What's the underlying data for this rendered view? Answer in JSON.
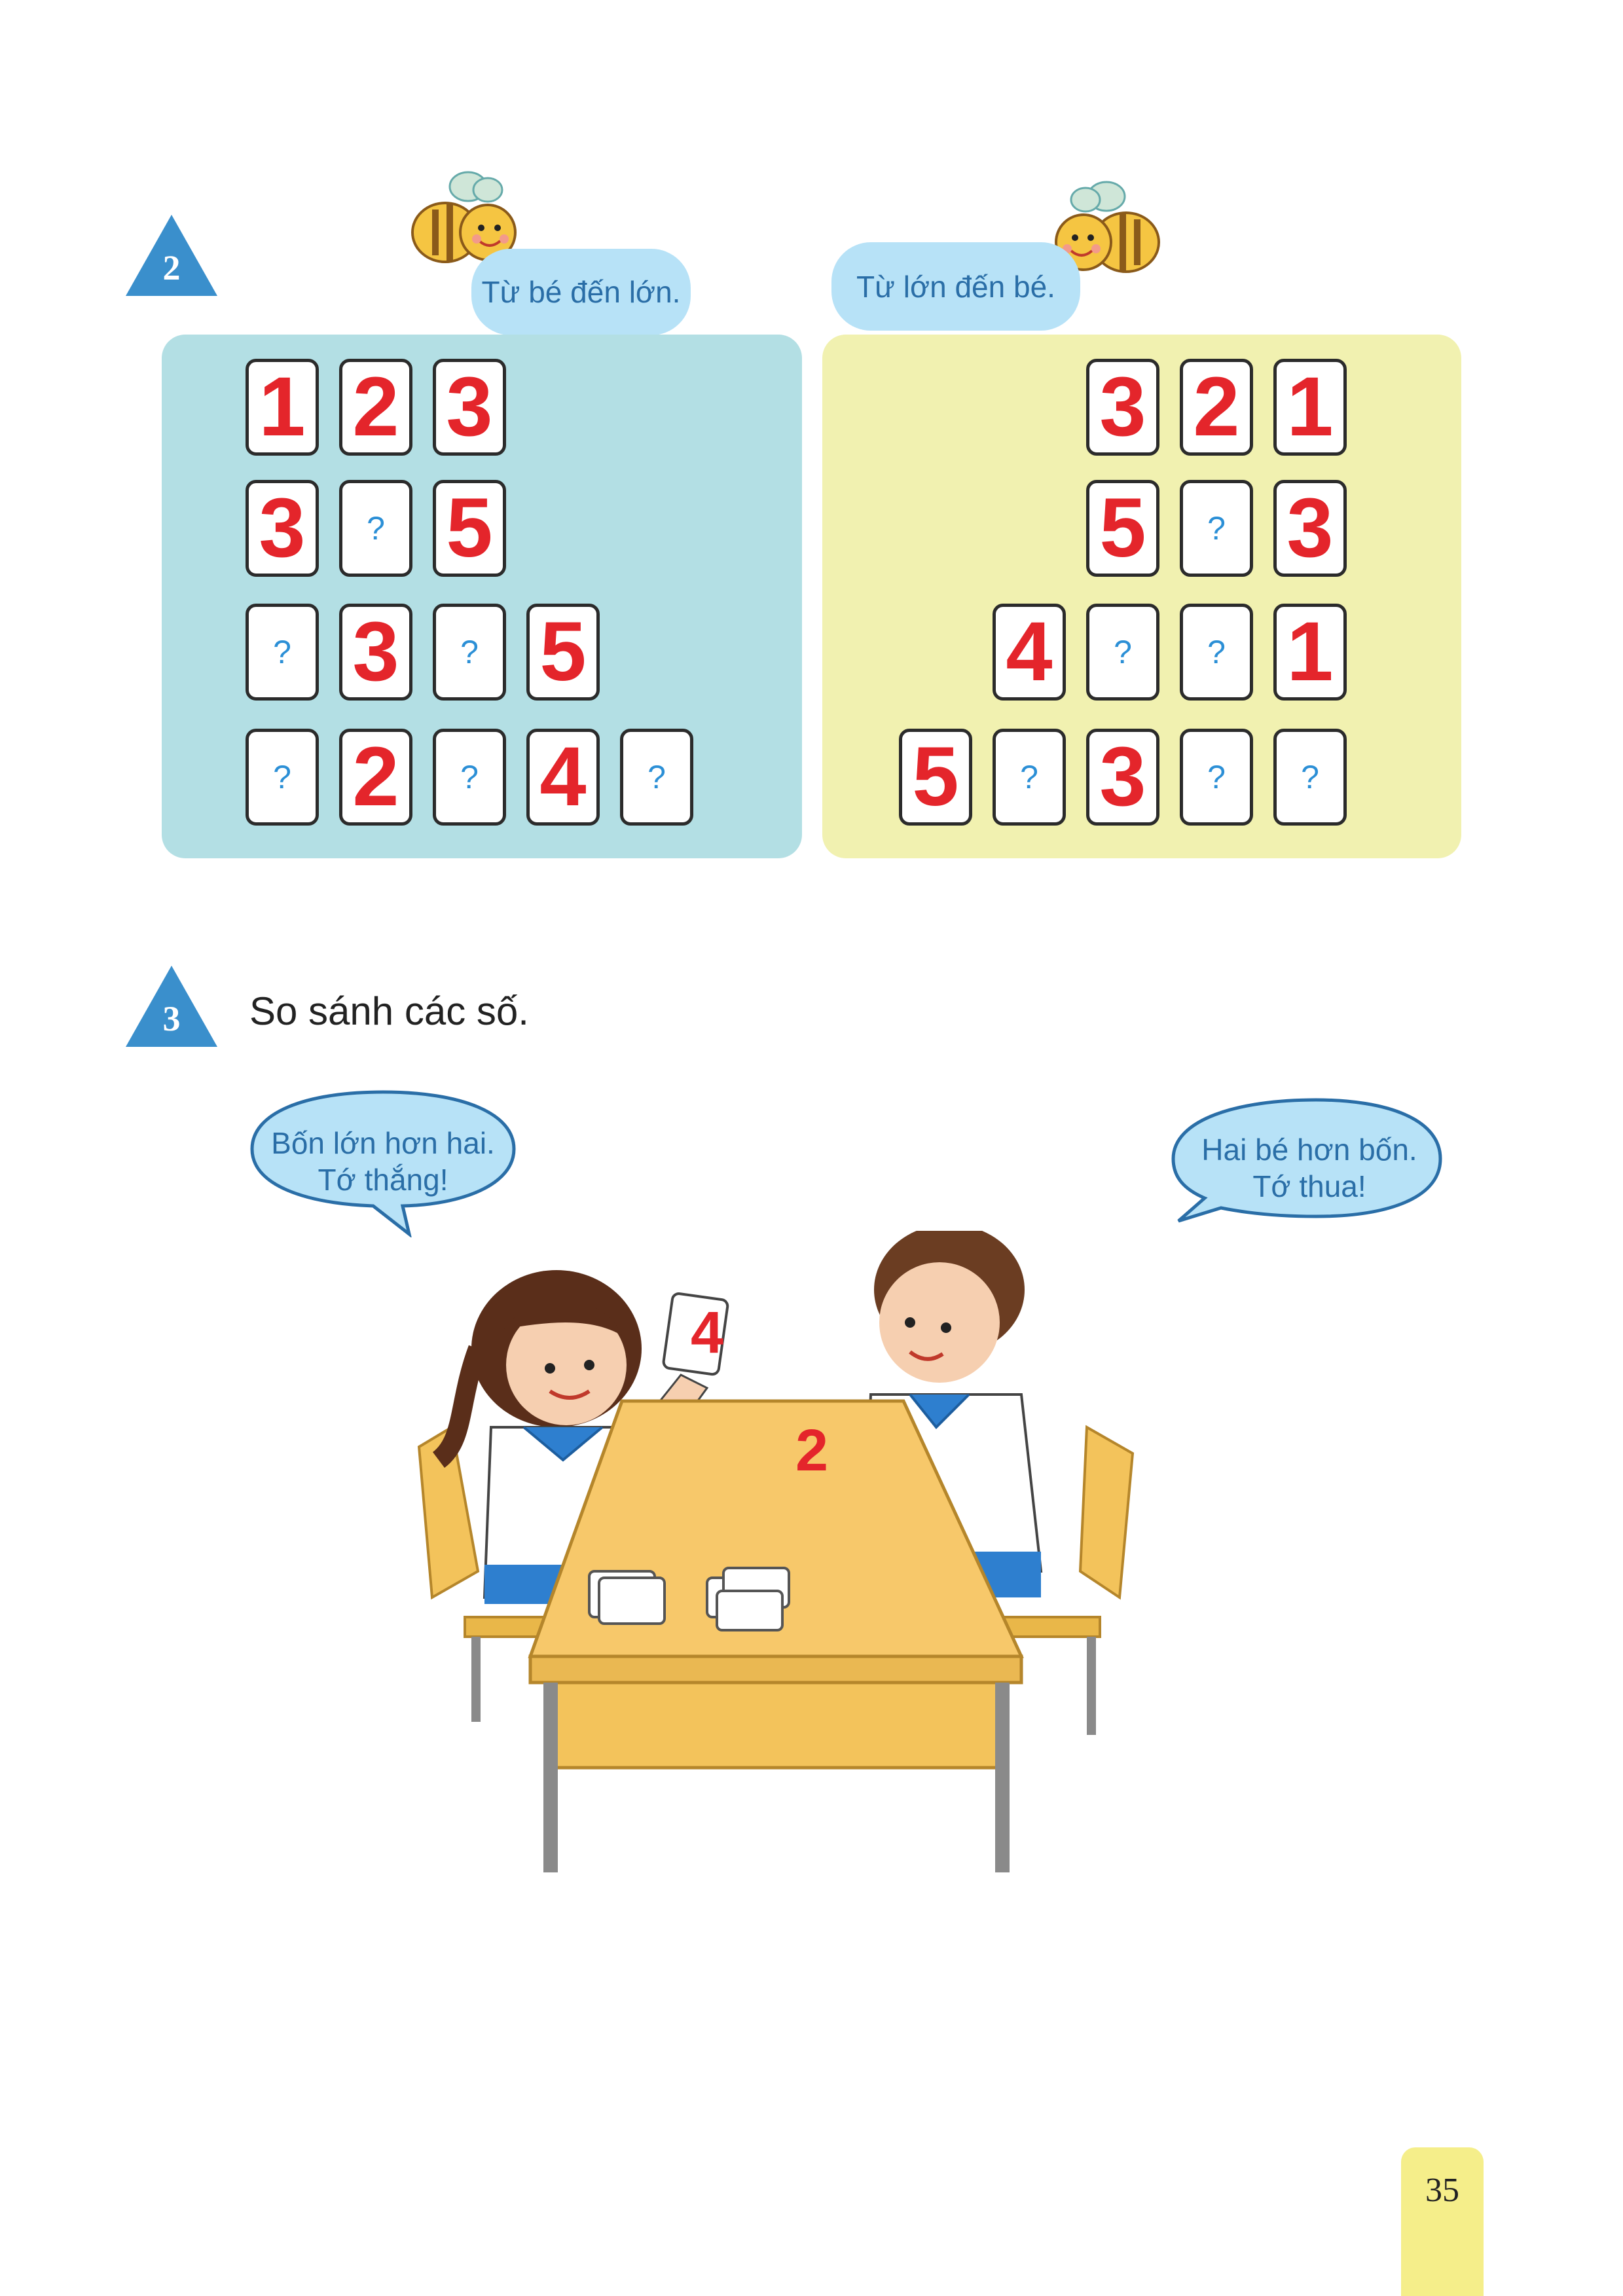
{
  "exercise2": {
    "number": "2",
    "left_caption": "Từ bé đến lớn.",
    "right_caption": "Từ lớn đến bé.",
    "left_rows": [
      [
        "1",
        "2",
        "3"
      ],
      [
        "3",
        "?",
        "5"
      ],
      [
        "?",
        "3",
        "?",
        "5"
      ],
      [
        "?",
        "2",
        "?",
        "4",
        "?"
      ]
    ],
    "right_rows": [
      [
        "3",
        "2",
        "1"
      ],
      [
        "5",
        "?",
        "3"
      ],
      [
        "4",
        "?",
        "?",
        "1"
      ],
      [
        "5",
        "?",
        "3",
        "?",
        "?"
      ]
    ]
  },
  "exercise3": {
    "number": "3",
    "title": "So sánh các số.",
    "girl_speech": [
      "Bốn lớn hơn hai.",
      "Tớ thắng!"
    ],
    "boy_speech": [
      "Hai bé hơn bốn.",
      "Tớ thua!"
    ],
    "girl_card": "4",
    "boy_card": "2"
  },
  "colors": {
    "badge": "#3a8fcc",
    "panel_left": "#b3dfe4",
    "panel_right": "#f1f1b0",
    "number": "#e4252b",
    "question": "#2b8fd6"
  },
  "page_number": "35"
}
